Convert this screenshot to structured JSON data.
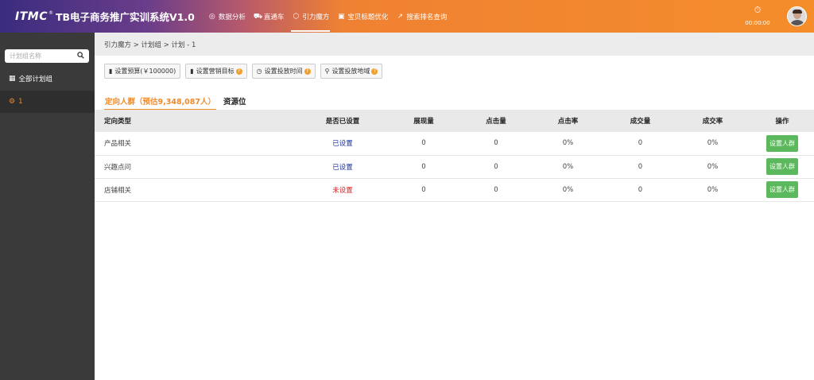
{
  "app": {
    "logo": "ITMC",
    "reg_mark": "®",
    "title": "TB电子商务推广实训系统V1.0"
  },
  "nav": [
    {
      "label": "数据分析",
      "icon": "target-icon",
      "glyph": "◎"
    },
    {
      "label": "直通车",
      "icon": "car-icon",
      "glyph": "⛟"
    },
    {
      "label": "引力魔方",
      "icon": "cube-icon",
      "glyph": "⬡",
      "active": true
    },
    {
      "label": "宝贝标题优化",
      "icon": "tag-icon",
      "glyph": "▣"
    },
    {
      "label": "搜索排名查询",
      "icon": "trend-icon",
      "glyph": "↗"
    }
  ],
  "timer": {
    "icon": "stopwatch-icon",
    "glyph": "⏱",
    "value": "00:00:00"
  },
  "sidebar": {
    "search_placeholder": "计划组名称",
    "search_icon": "search-icon",
    "items": [
      {
        "label": "全部计划组",
        "icon": "grid-icon",
        "glyph": "▦"
      },
      {
        "label": "1",
        "icon": "gear-icon",
        "glyph": "⚙"
      }
    ]
  },
  "breadcrumb": "引力魔方 > 计划组 > 计划 - 1",
  "toolbar": [
    {
      "label": "设置预算(￥100000)",
      "icon": "bar-chart-icon",
      "glyph": "▮",
      "help": false
    },
    {
      "label": "设置营销目标",
      "icon": "bar-chart-icon",
      "glyph": "▮",
      "help": true
    },
    {
      "label": "设置投放时间",
      "icon": "clock-icon",
      "glyph": "◷",
      "help": true
    },
    {
      "label": "设置投放地域",
      "icon": "location-pin-icon",
      "glyph": "⚲",
      "help": true
    }
  ],
  "help_glyph": "?",
  "tabs": [
    {
      "label": "定向人群（预估9,348,087人）",
      "active": true
    },
    {
      "label": "资源位",
      "active": false
    }
  ],
  "table": {
    "headers": [
      "定向类型",
      "是否已设置",
      "展现量",
      "点击量",
      "点击率",
      "成交量",
      "成交率",
      "操作"
    ],
    "rows": [
      {
        "type": "产品相关",
        "status": "已设置",
        "set": true,
        "impressions": "0",
        "clicks": "0",
        "ctr": "0%",
        "deals": "0",
        "conv": "0%",
        "action": "设置人群"
      },
      {
        "type": "兴趣点问",
        "status": "已设置",
        "set": true,
        "impressions": "0",
        "clicks": "0",
        "ctr": "0%",
        "deals": "0",
        "conv": "0%",
        "action": "设置人群"
      },
      {
        "type": "店铺相关",
        "status": "未设置",
        "set": false,
        "impressions": "0",
        "clicks": "0",
        "ctr": "0%",
        "deals": "0",
        "conv": "0%",
        "action": "设置人群"
      }
    ]
  },
  "colors": {
    "accent": "#f08a2a",
    "header_left": "#3a2c7e",
    "header_right": "#f58d2b",
    "sidebar_bg": "#3a3a3a",
    "action_btn": "#5cb85c",
    "status_set": "#1a2fa0",
    "status_unset": "#d42020"
  }
}
